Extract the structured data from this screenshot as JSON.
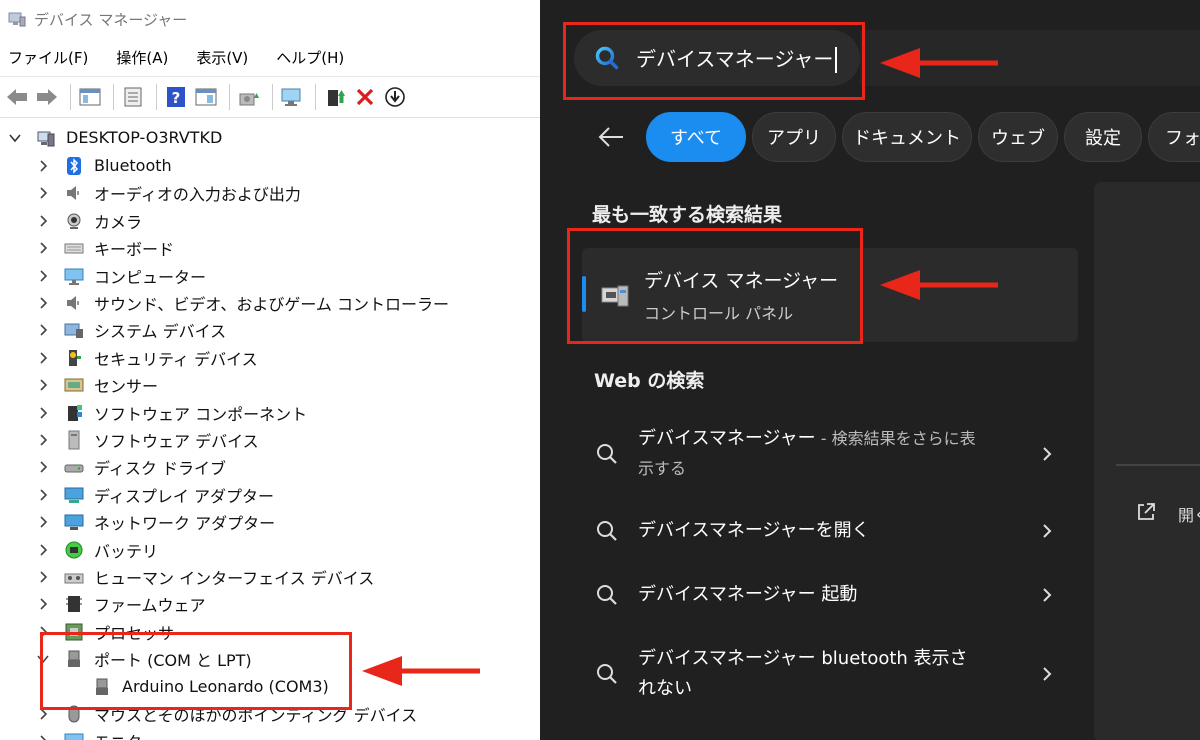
{
  "window": {
    "title": "デバイス マネージャー"
  },
  "menu": [
    "ファイル(F)",
    "操作(A)",
    "表示(V)",
    "ヘルプ(H)"
  ],
  "tree": {
    "root": "DESKTOP-O3RVTKD",
    "items": [
      {
        "label": "Bluetooth",
        "icon": "bluetooth-icon"
      },
      {
        "label": "オーディオの入力および出力",
        "icon": "speaker-icon"
      },
      {
        "label": "カメラ",
        "icon": "camera-icon"
      },
      {
        "label": "キーボード",
        "icon": "keyboard-icon"
      },
      {
        "label": "コンピューター",
        "icon": "monitor-icon"
      },
      {
        "label": "サウンド、ビデオ、およびゲーム コントローラー",
        "icon": "speaker-icon"
      },
      {
        "label": "システム デバイス",
        "icon": "system-device-icon"
      },
      {
        "label": "セキュリティ デバイス",
        "icon": "security-device-icon"
      },
      {
        "label": "センサー",
        "icon": "sensor-icon"
      },
      {
        "label": "ソフトウェア コンポーネント",
        "icon": "software-component-icon"
      },
      {
        "label": "ソフトウェア デバイス",
        "icon": "software-device-icon"
      },
      {
        "label": "ディスク ドライブ",
        "icon": "disk-drive-icon"
      },
      {
        "label": "ディスプレイ アダプター",
        "icon": "display-adapter-icon"
      },
      {
        "label": "ネットワーク アダプター",
        "icon": "network-adapter-icon"
      },
      {
        "label": "バッテリ",
        "icon": "battery-icon"
      },
      {
        "label": "ヒューマン インターフェイス デバイス",
        "icon": "hid-icon"
      },
      {
        "label": "ファームウェア",
        "icon": "firmware-icon"
      },
      {
        "label": "プロセッサ",
        "icon": "processor-icon"
      }
    ],
    "ports": {
      "label": "ポート (COM と LPT)",
      "child": "Arduino Leonardo (COM3)"
    },
    "after": [
      "マウスとそのほかのポインティング デバイス",
      "モニター"
    ]
  },
  "search": {
    "query": "デバイスマネージャー",
    "filters": [
      "すべて",
      "アプリ",
      "ドキュメント",
      "ウェブ",
      "設定",
      "フォル"
    ],
    "best_match_heading": "最も一致する検索結果",
    "best_match": {
      "title": "デバイス マネージャー",
      "subtitle": "コントロール パネル"
    },
    "web_heading": "Web の検索",
    "web_results": [
      {
        "main": "デバイスマネージャー",
        "sub": " - 検索結果をさらに表示する"
      },
      {
        "main": "デバイスマネージャーを開く",
        "sub": ""
      },
      {
        "main": "デバイスマネージャー 起動",
        "sub": ""
      },
      {
        "main": "デバイスマネージャー bluetooth 表示されない",
        "sub": ""
      }
    ],
    "preview_action": "開く"
  },
  "colors": {
    "accent": "#1b8cf0",
    "highlight": "#e8261a",
    "panel_bg": "#202020"
  }
}
